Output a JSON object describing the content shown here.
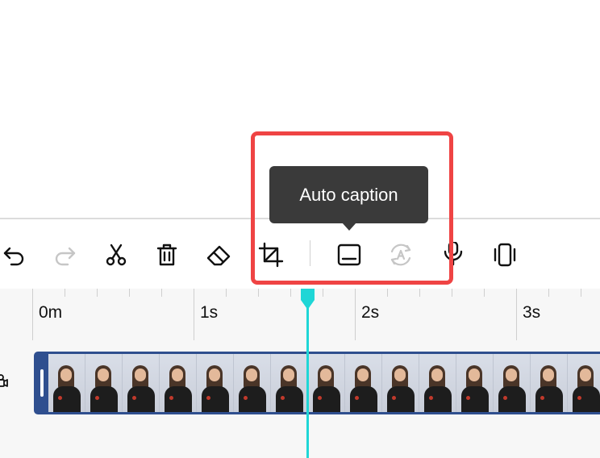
{
  "toolbar": {
    "tools": [
      {
        "name": "undo",
        "icon": "undo-icon",
        "enabled": true
      },
      {
        "name": "redo",
        "icon": "redo-icon",
        "enabled": false
      },
      {
        "name": "split",
        "icon": "scissors-icon",
        "enabled": true
      },
      {
        "name": "delete",
        "icon": "trash-icon",
        "enabled": true
      },
      {
        "name": "erase",
        "icon": "eraser-icon",
        "enabled": true
      },
      {
        "name": "crop",
        "icon": "crop-icon",
        "enabled": true
      },
      {
        "name": "auto-caption",
        "icon": "caption-icon",
        "enabled": true
      },
      {
        "name": "auto-translate",
        "icon": "auto-text-icon",
        "enabled": false
      },
      {
        "name": "voiceover",
        "icon": "microphone-icon",
        "enabled": true
      },
      {
        "name": "resize",
        "icon": "phone-vibrate-icon",
        "enabled": true
      }
    ]
  },
  "tooltip": {
    "text": "Auto caption"
  },
  "timeline": {
    "ruler_labels": [
      "0m",
      "1s",
      "2s",
      "3s"
    ],
    "track_frame_count": 15
  },
  "colors": {
    "highlight": "#ef4444",
    "playhead": "#1fd6d6",
    "track": "#2f4f8f",
    "tooltip_bg": "#3a3a3a"
  }
}
